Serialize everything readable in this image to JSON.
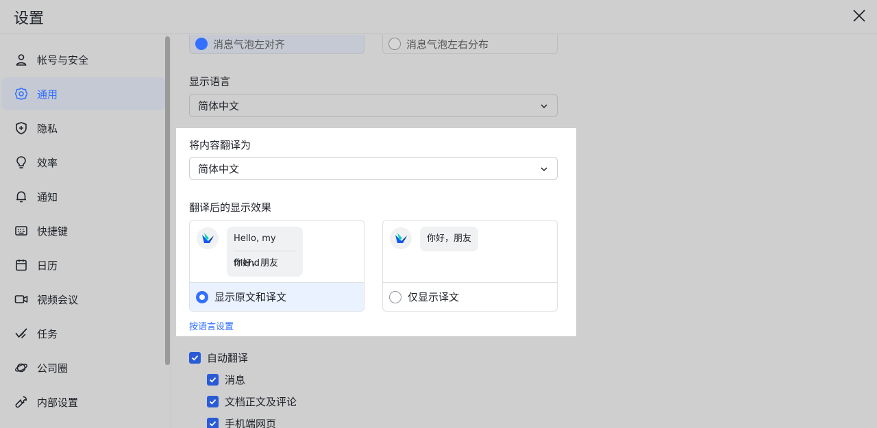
{
  "header": {
    "title": "设置"
  },
  "sidebar": {
    "items": [
      {
        "label": "帐号与安全",
        "icon": "user-icon"
      },
      {
        "label": "通用",
        "icon": "gear-icon",
        "active": true
      },
      {
        "label": "隐私",
        "icon": "shield-icon"
      },
      {
        "label": "效率",
        "icon": "lightbulb-icon"
      },
      {
        "label": "通知",
        "icon": "bell-icon"
      },
      {
        "label": "快捷键",
        "icon": "keyboard-icon"
      },
      {
        "label": "日历",
        "icon": "calendar-icon"
      },
      {
        "label": "视频会议",
        "icon": "video-icon"
      },
      {
        "label": "任务",
        "icon": "task-check-icon"
      },
      {
        "label": "公司圈",
        "icon": "planet-icon"
      },
      {
        "label": "内部设置",
        "icon": "wrench-icon"
      }
    ]
  },
  "main": {
    "bubble_align": {
      "left_label": "消息气泡左对齐",
      "spread_label": "消息气泡左右分布"
    },
    "display_language": {
      "label": "显示语言",
      "value": "简体中文"
    },
    "translate_to": {
      "label": "将内容翻译为",
      "value": "简体中文"
    },
    "translate_display": {
      "label": "翻译后的显示效果",
      "option_both": {
        "original": "Hello, my friend",
        "translated": "你好，朋友",
        "label": "显示原文和译文",
        "selected": true
      },
      "option_only": {
        "translated": "你好，朋友",
        "label": "仅显示译文",
        "selected": false
      }
    },
    "by_language_link": "按语言设置",
    "auto_translate": {
      "label": "自动翻译",
      "items": [
        {
          "label": "消息",
          "checked": true
        },
        {
          "label": "文档正文及评论",
          "checked": true
        },
        {
          "label": "手机端网页",
          "checked": true
        }
      ]
    }
  },
  "colors": {
    "accent": "#3370ff",
    "checkbox": "#2a5bd7",
    "overlay": "#cfcfcf"
  }
}
